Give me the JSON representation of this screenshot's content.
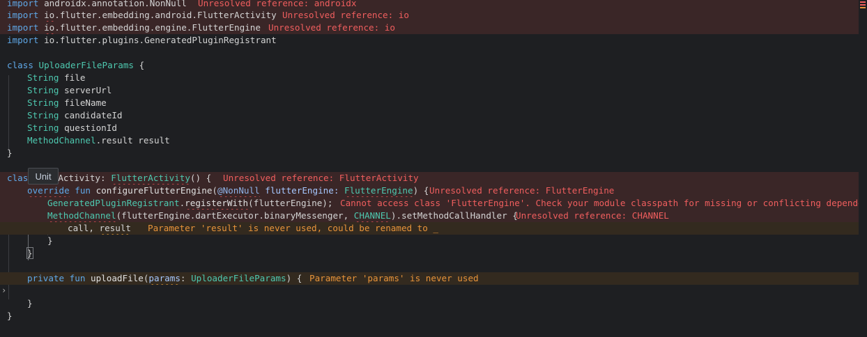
{
  "lines": {
    "l1": {
      "t1": "import ",
      "t2": "androidx",
      "t3": ".annotation.NonNull",
      "msg": "Unresolved reference: androidx"
    },
    "l2": {
      "t1": "import ",
      "t2": "io",
      "t3": ".flutter.embedding.android.FlutterActivity",
      "msg": "Unresolved reference: io"
    },
    "l3": {
      "t1": "import ",
      "t2": "io",
      "t3": ".flutter.embedding.engine.FlutterEngine",
      "msg": "Unresolved reference: io"
    },
    "l4": {
      "t1": "import ",
      "t2": "io.flutter.plugins.GeneratedPluginRegistrant"
    },
    "l6": {
      "t1": "class ",
      "t2": "UploaderFileParams",
      " t3": " {",
      "t3x": " {"
    },
    "l7": {
      "t1": "String",
      "t2": " file"
    },
    "l8": {
      "t1": "String",
      "t2": " serverUrl"
    },
    "l9": {
      "t1": "String",
      "t2": " fileName"
    },
    "l10": {
      "t1": "String",
      "t2": " candidateId"
    },
    "l11": {
      "t1": "String",
      "t2": " questionId"
    },
    "l12": {
      "t1": "MethodChannel",
      "t2": ".result result"
    },
    "l13": {
      "t1": "}"
    },
    "l15": {
      "t1": "clas",
      "t2": "Activity",
      "t3": ": ",
      "t4": "FlutterActivity",
      "t5": "() {",
      "msg": "Unresolved reference: FlutterActivity"
    },
    "l16": {
      "t1": "override",
      "t2": " fun ",
      "t3": "configureFlutterEngine",
      "t4": "(",
      "t5": "@NonNull",
      "t6": " flutterEngine: ",
      "t7": "FlutterEngine",
      "t8": ") {",
      "msg": "Unresolved reference: FlutterEngine"
    },
    "l17": {
      "t1": "GeneratedPluginRegistrant",
      "t2": ".",
      "t3": "registerWith",
      "t4": "(flutterEngine);",
      "msg": "Cannot access class 'FlutterEngine'. Check your module classpath for missing or conflicting dependencies"
    },
    "l18": {
      "t1": "MethodChannel",
      "t2": "(flutterEngine.dartExecutor.binaryMessenger, ",
      "t3": "CHANNEL",
      "t4": ").setMethodCallHandler {",
      "msg": "Unresolved reference: CHANNEL"
    },
    "l19": {
      "t1": "call, ",
      "t2": "result",
      "msg": "Parameter 'result' is never used, could be renamed to _"
    },
    "l20": {
      "t1": "}"
    },
    "l21": {
      "t1": "}"
    },
    "l23": {
      "t1": "private fun ",
      "t2": "uploadFile",
      "t3": "(",
      "t4": "params",
      "t5": ": ",
      "t6": "UploaderFileParams",
      "t7": ") {",
      "msg": "Parameter 'params' is never used"
    },
    "l25": {
      "t1": "}"
    },
    "l26": {
      "t1": "}"
    }
  },
  "tooltip": {
    "text": "Unit"
  },
  "icons": {
    "fold": "chevron-right-icon"
  },
  "colors": {
    "error": "#f05e5e",
    "warning": "#e8943a",
    "keyword": "#5fa8e8",
    "type": "#4ec9b0",
    "error_bg": "#3a2627",
    "warning_bg": "#332a1f"
  }
}
